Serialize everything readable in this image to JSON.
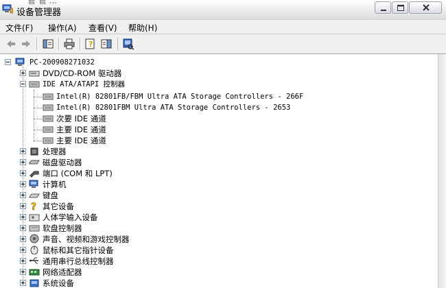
{
  "window": {
    "title": "设备管理器",
    "title_ghost": "管 管 ...",
    "accent": "#f0f0f0"
  },
  "menu": [
    {
      "label": "文件(F)"
    },
    {
      "label": "操作(A)"
    },
    {
      "label": "查看(V)"
    },
    {
      "label": "帮助(H)"
    }
  ],
  "toolbar": [
    {
      "icon": "back-arrow-icon"
    },
    {
      "icon": "forward-arrow-icon"
    },
    {
      "icon": "show-hide-tree-icon"
    },
    {
      "icon": "print-icon"
    },
    {
      "icon": "help-properties-icon"
    },
    {
      "icon": "properties-pane-icon"
    },
    {
      "icon": "scan-hardware-icon"
    }
  ],
  "tree": {
    "root": "PC-200908271032",
    "dvd": "DVD/CD-ROM 驱动器",
    "ide": "IDE ATA/ATAPI 控制器",
    "ide_children": [
      "Intel(R) 82801FB/FBM Ultra ATA Storage Controllers - 266F",
      "Intel(R) 82801FBM Ultra ATA Storage Controllers - 2653",
      "次要 IDE 通道",
      "主要 IDE 通道",
      "主要 IDE 通道"
    ],
    "categories": [
      "处理器",
      "磁盘驱动器",
      "端口 (COM 和 LPT)",
      "计算机",
      "键盘",
      "其它设备",
      "人体学输入设备",
      "软盘控制器",
      "声音、视频和游戏控制器",
      "鼠标和其它指针设备",
      "通用串行总线控制器",
      "网络适配器",
      "系统设备"
    ]
  }
}
